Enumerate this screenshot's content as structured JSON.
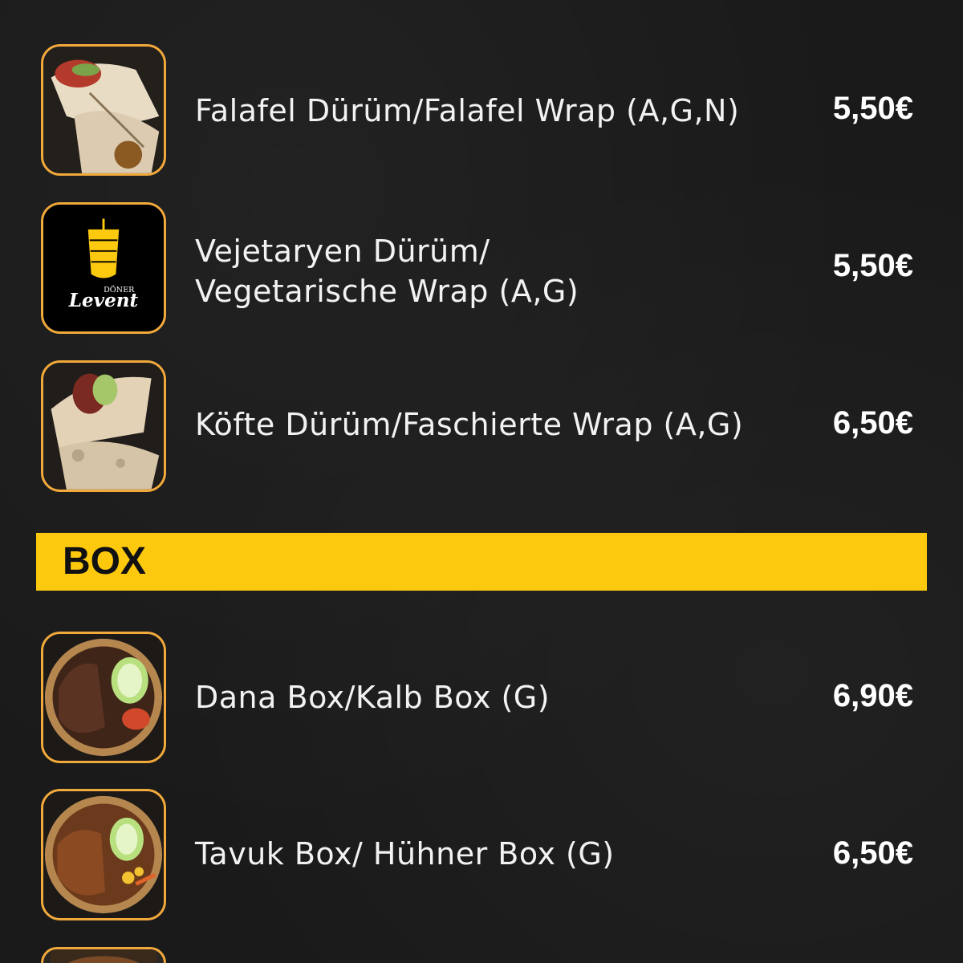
{
  "wrap_items": [
    {
      "name_line1": "Falafel Dürüm/Falafel Wrap (A,G,N)",
      "price": "5,50€",
      "icon": "falafel-wrap-photo"
    },
    {
      "name_line1": "Vejetaryen Dürüm/",
      "name_line2": "Vegetarische Wrap (A,G)",
      "price": "5,50€",
      "icon": "doner-levent-logo"
    },
    {
      "name_line1": "Köfte Dürüm/Faschierte Wrap (A,G)",
      "price": "6,50€",
      "icon": "kofte-wrap-photo"
    }
  ],
  "section": {
    "title": "BOX"
  },
  "box_items": [
    {
      "name_line1": "Dana Box/Kalb Box (G)",
      "price": "6,90€",
      "icon": "beef-box-photo"
    },
    {
      "name_line1": "Tavuk Box/ Hühner Box (G)",
      "price": "6,50€",
      "icon": "chicken-box-photo"
    }
  ],
  "logo": {
    "text_top": "DÖNER",
    "text_main": "Levent"
  },
  "colors": {
    "accent": "#fdc90e",
    "thumb_border": "#f2a93b",
    "background": "#1a1a1a"
  }
}
